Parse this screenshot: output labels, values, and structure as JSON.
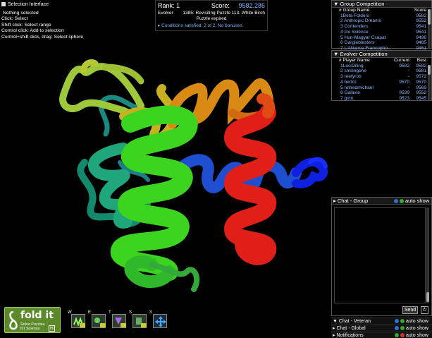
{
  "selection_interface": {
    "title": "Selection Interface",
    "lines": [
      "Nothing selected",
      "Click: Select",
      "Shift click: Select range",
      "Control click: Add to selection",
      "Control+shift click, drag: Select sphere"
    ]
  },
  "score_panel": {
    "rank_label": "Rank: 1",
    "score_label": "Score:",
    "score_value": "9582.286",
    "mode": "Evolver",
    "puzzle": "1385: Revisiting Puzzle 113: White Birch",
    "status": "Puzzle expired",
    "conditions": "Conditions satisfied: 2 of 2. No bonuses."
  },
  "group_competition": {
    "title": "Group Competition",
    "headers": [
      "# Group Name",
      "Score"
    ],
    "rows": [
      [
        "1Beta Folders",
        "9582"
      ],
      [
        "2 Anthropic Dreams",
        "9552"
      ],
      [
        "3 Contenders",
        "9541"
      ],
      [
        "4 Go Science",
        "9541"
      ],
      [
        "5 Hun-Magyar Csapat",
        "9496"
      ],
      [
        "6 Gargleblasters",
        "9485"
      ],
      [
        "7 L'Alliance Francopho...",
        "9461"
      ]
    ]
  },
  "evolver_competition": {
    "title": "Evolver Competition",
    "headers": [
      "# Player Name",
      "Current",
      "Best"
    ],
    "rows": [
      [
        "1LociOiling",
        "9582",
        "9582"
      ],
      [
        "2 smilingone",
        "-",
        "9581"
      ],
      [
        "3 reefyrob",
        "-",
        "9572"
      ],
      [
        "4 bertro",
        "9570",
        "9570"
      ],
      [
        "5 retiredmichael",
        "-",
        "9569"
      ],
      [
        "6 Galaxie",
        "9539",
        "9552"
      ],
      [
        "7 gmn",
        "9523",
        "9545"
      ]
    ]
  },
  "chat_group": {
    "title": "Chat - Group",
    "auto_show": "auto show",
    "send_label": "Send"
  },
  "bottom_bars": [
    {
      "title": "Chat - Veteran",
      "auto_show": "auto show"
    },
    {
      "title": "Chat - Global",
      "auto_show": "auto show"
    },
    {
      "title": "Notifications",
      "auto_show": "auto show"
    }
  ],
  "logo": {
    "word": "fold it",
    "tagline_1": "Solve Puzzles",
    "tagline_2": "for Science",
    "version": "H"
  },
  "toolbar": [
    {
      "key": "W",
      "icon": "wiggle-icon"
    },
    {
      "key": "E",
      "icon": "shake-icon"
    },
    {
      "key": "T",
      "icon": "tweak-icon"
    },
    {
      "key": "S",
      "icon": "scripts-icon"
    },
    {
      "key": "3",
      "icon": "move-icon"
    }
  ]
}
